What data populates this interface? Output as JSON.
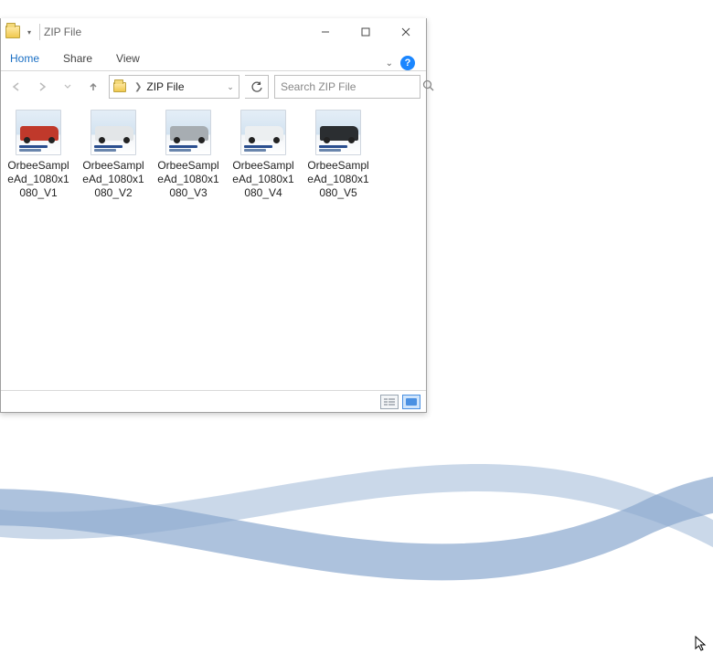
{
  "window": {
    "title": "ZIP File",
    "minimize_tip": "Minimize",
    "maximize_tip": "Maximize",
    "close_tip": "Close"
  },
  "ribbon": {
    "tabs": [
      "Home",
      "Share",
      "View"
    ],
    "help_tip": "Help"
  },
  "nav": {
    "back_tip": "Back",
    "forward_tip": "Forward",
    "up_tip": "Up",
    "refresh_tip": "Refresh"
  },
  "address": {
    "current": "ZIP File"
  },
  "search": {
    "placeholder": "Search ZIP File"
  },
  "files": [
    {
      "name": "OrbeeSampleAd_1080x1080_V1",
      "car_color": "#c0392b"
    },
    {
      "name": "OrbeeSampleAd_1080x1080_V2",
      "car_color": "#e3e6e8"
    },
    {
      "name": "OrbeeSampleAd_1080x1080_V3",
      "car_color": "#a7adb2"
    },
    {
      "name": "OrbeeSampleAd_1080x1080_V4",
      "car_color": "#eceff1"
    },
    {
      "name": "OrbeeSampleAd_1080x1080_V5",
      "car_color": "#2b2e31"
    }
  ],
  "status": {
    "details_view_tip": "Details",
    "thumb_view_tip": "Large icons"
  }
}
